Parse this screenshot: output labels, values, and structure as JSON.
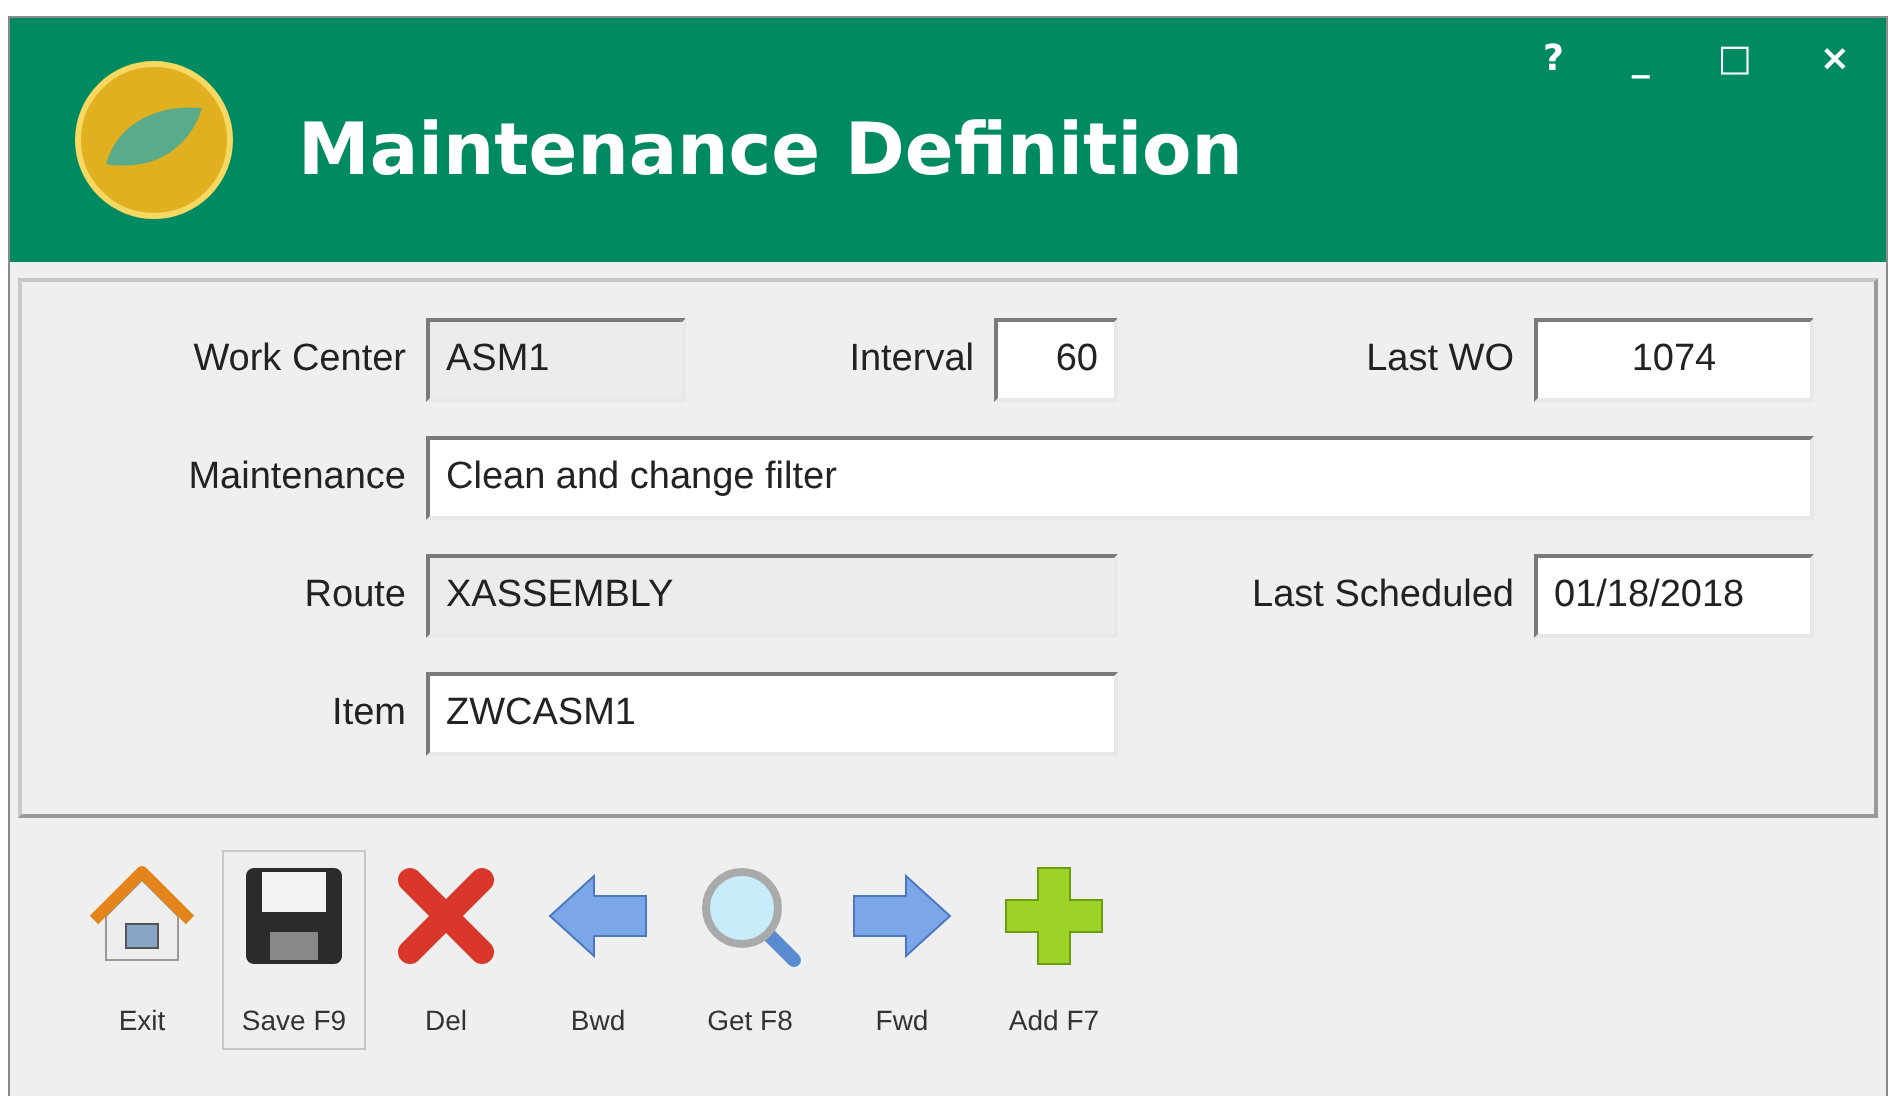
{
  "window": {
    "title": "Maintenance Definition",
    "controls": [
      "?",
      "_",
      "□",
      "×"
    ]
  },
  "form": {
    "fields": [
      {
        "label": "Work Center",
        "value": "ASM1",
        "editable": false
      },
      {
        "label": "Interval",
        "value": "60",
        "editable": true
      },
      {
        "label": "Last WO",
        "value": "1074",
        "editable": true
      },
      {
        "label": "Maintenance",
        "value": "Clean and change filter",
        "editable": true
      },
      {
        "label": "Route",
        "value": "XASSEMBLY",
        "editable": false
      },
      {
        "label": "Last Scheduled",
        "value": "01/18/2018",
        "editable": true
      },
      {
        "label": "Item",
        "value": "ZWCASM1",
        "editable": true
      }
    ]
  },
  "toolbar": [
    {
      "kind": "exit",
      "label": "Exit",
      "highlighted": false
    },
    {
      "kind": "save",
      "label": "Save F9",
      "highlighted": true
    },
    {
      "kind": "delete",
      "label": "Del",
      "highlighted": false
    },
    {
      "kind": "back",
      "label": "Bwd",
      "highlighted": false
    },
    {
      "kind": "search",
      "label": "Get F8",
      "highlighted": false
    },
    {
      "kind": "forward",
      "label": "Fwd",
      "highlighted": false
    },
    {
      "kind": "add",
      "label": "Add F7",
      "highlighted": false
    }
  ]
}
